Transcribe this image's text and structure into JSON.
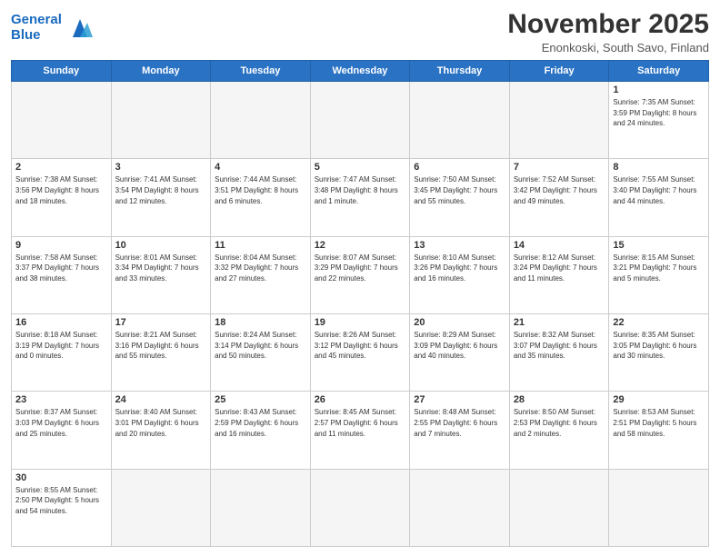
{
  "header": {
    "logo_line1": "General",
    "logo_line2": "Blue",
    "month": "November 2025",
    "location": "Enonkoski, South Savo, Finland"
  },
  "days_of_week": [
    "Sunday",
    "Monday",
    "Tuesday",
    "Wednesday",
    "Thursday",
    "Friday",
    "Saturday"
  ],
  "weeks": [
    [
      {
        "day": "",
        "info": ""
      },
      {
        "day": "",
        "info": ""
      },
      {
        "day": "",
        "info": ""
      },
      {
        "day": "",
        "info": ""
      },
      {
        "day": "",
        "info": ""
      },
      {
        "day": "",
        "info": ""
      },
      {
        "day": "1",
        "info": "Sunrise: 7:35 AM\nSunset: 3:59 PM\nDaylight: 8 hours\nand 24 minutes."
      }
    ],
    [
      {
        "day": "2",
        "info": "Sunrise: 7:38 AM\nSunset: 3:56 PM\nDaylight: 8 hours\nand 18 minutes."
      },
      {
        "day": "3",
        "info": "Sunrise: 7:41 AM\nSunset: 3:54 PM\nDaylight: 8 hours\nand 12 minutes."
      },
      {
        "day": "4",
        "info": "Sunrise: 7:44 AM\nSunset: 3:51 PM\nDaylight: 8 hours\nand 6 minutes."
      },
      {
        "day": "5",
        "info": "Sunrise: 7:47 AM\nSunset: 3:48 PM\nDaylight: 8 hours\nand 1 minute."
      },
      {
        "day": "6",
        "info": "Sunrise: 7:50 AM\nSunset: 3:45 PM\nDaylight: 7 hours\nand 55 minutes."
      },
      {
        "day": "7",
        "info": "Sunrise: 7:52 AM\nSunset: 3:42 PM\nDaylight: 7 hours\nand 49 minutes."
      },
      {
        "day": "8",
        "info": "Sunrise: 7:55 AM\nSunset: 3:40 PM\nDaylight: 7 hours\nand 44 minutes."
      }
    ],
    [
      {
        "day": "9",
        "info": "Sunrise: 7:58 AM\nSunset: 3:37 PM\nDaylight: 7 hours\nand 38 minutes."
      },
      {
        "day": "10",
        "info": "Sunrise: 8:01 AM\nSunset: 3:34 PM\nDaylight: 7 hours\nand 33 minutes."
      },
      {
        "day": "11",
        "info": "Sunrise: 8:04 AM\nSunset: 3:32 PM\nDaylight: 7 hours\nand 27 minutes."
      },
      {
        "day": "12",
        "info": "Sunrise: 8:07 AM\nSunset: 3:29 PM\nDaylight: 7 hours\nand 22 minutes."
      },
      {
        "day": "13",
        "info": "Sunrise: 8:10 AM\nSunset: 3:26 PM\nDaylight: 7 hours\nand 16 minutes."
      },
      {
        "day": "14",
        "info": "Sunrise: 8:12 AM\nSunset: 3:24 PM\nDaylight: 7 hours\nand 11 minutes."
      },
      {
        "day": "15",
        "info": "Sunrise: 8:15 AM\nSunset: 3:21 PM\nDaylight: 7 hours\nand 5 minutes."
      }
    ],
    [
      {
        "day": "16",
        "info": "Sunrise: 8:18 AM\nSunset: 3:19 PM\nDaylight: 7 hours\nand 0 minutes."
      },
      {
        "day": "17",
        "info": "Sunrise: 8:21 AM\nSunset: 3:16 PM\nDaylight: 6 hours\nand 55 minutes."
      },
      {
        "day": "18",
        "info": "Sunrise: 8:24 AM\nSunset: 3:14 PM\nDaylight: 6 hours\nand 50 minutes."
      },
      {
        "day": "19",
        "info": "Sunrise: 8:26 AM\nSunset: 3:12 PM\nDaylight: 6 hours\nand 45 minutes."
      },
      {
        "day": "20",
        "info": "Sunrise: 8:29 AM\nSunset: 3:09 PM\nDaylight: 6 hours\nand 40 minutes."
      },
      {
        "day": "21",
        "info": "Sunrise: 8:32 AM\nSunset: 3:07 PM\nDaylight: 6 hours\nand 35 minutes."
      },
      {
        "day": "22",
        "info": "Sunrise: 8:35 AM\nSunset: 3:05 PM\nDaylight: 6 hours\nand 30 minutes."
      }
    ],
    [
      {
        "day": "23",
        "info": "Sunrise: 8:37 AM\nSunset: 3:03 PM\nDaylight: 6 hours\nand 25 minutes."
      },
      {
        "day": "24",
        "info": "Sunrise: 8:40 AM\nSunset: 3:01 PM\nDaylight: 6 hours\nand 20 minutes."
      },
      {
        "day": "25",
        "info": "Sunrise: 8:43 AM\nSunset: 2:59 PM\nDaylight: 6 hours\nand 16 minutes."
      },
      {
        "day": "26",
        "info": "Sunrise: 8:45 AM\nSunset: 2:57 PM\nDaylight: 6 hours\nand 11 minutes."
      },
      {
        "day": "27",
        "info": "Sunrise: 8:48 AM\nSunset: 2:55 PM\nDaylight: 6 hours\nand 7 minutes."
      },
      {
        "day": "28",
        "info": "Sunrise: 8:50 AM\nSunset: 2:53 PM\nDaylight: 6 hours\nand 2 minutes."
      },
      {
        "day": "29",
        "info": "Sunrise: 8:53 AM\nSunset: 2:51 PM\nDaylight: 5 hours\nand 58 minutes."
      }
    ],
    [
      {
        "day": "30",
        "info": "Sunrise: 8:55 AM\nSunset: 2:50 PM\nDaylight: 5 hours\nand 54 minutes."
      },
      {
        "day": "",
        "info": ""
      },
      {
        "day": "",
        "info": ""
      },
      {
        "day": "",
        "info": ""
      },
      {
        "day": "",
        "info": ""
      },
      {
        "day": "",
        "info": ""
      },
      {
        "day": "",
        "info": ""
      }
    ]
  ]
}
